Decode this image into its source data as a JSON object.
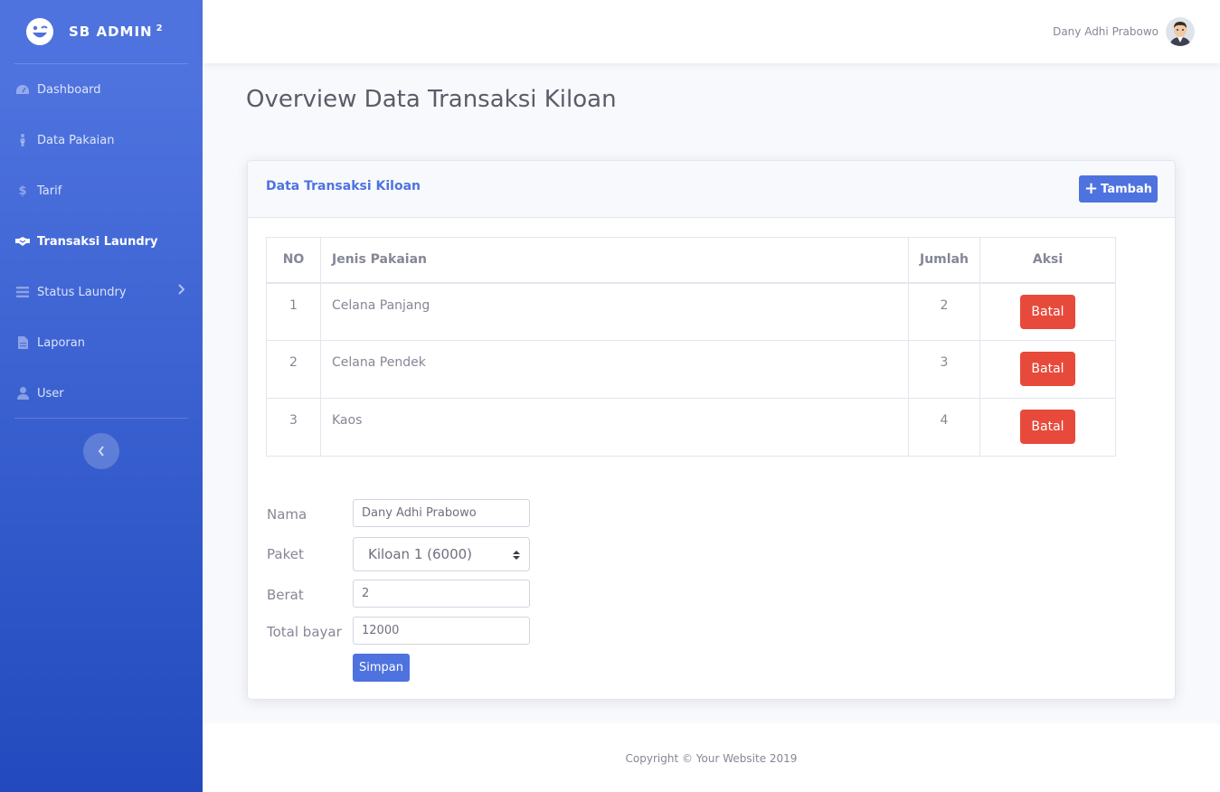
{
  "brand": {
    "name": "SB ADMIN",
    "sup": "2",
    "icon": "laugh-wink-icon"
  },
  "sidebar": {
    "items": [
      {
        "label": "Dashboard",
        "icon": "tachometer-icon"
      },
      {
        "label": "Data Pakaian",
        "icon": "person-icon"
      },
      {
        "label": "Tarif",
        "icon": "dollar-icon"
      },
      {
        "label": "Transaksi Laundry",
        "icon": "handshake-icon",
        "active": true
      },
      {
        "label": "Status Laundry",
        "icon": "bars-icon",
        "has_submenu": true
      },
      {
        "label": "Laporan",
        "icon": "file-icon"
      },
      {
        "label": "User",
        "icon": "user-icon"
      }
    ],
    "toggle_icon": "chevron-left-icon"
  },
  "topbar": {
    "user_name": "Dany Adhi Prabowo",
    "avatar_icon": "avatar"
  },
  "page": {
    "title": "Overview Data Transaksi Kiloan"
  },
  "card": {
    "title": "Data Transaksi Kiloan",
    "add_button": "Tambah",
    "table": {
      "headers": [
        "NO",
        "Jenis Pakaian",
        "Jumlah",
        "Aksi"
      ],
      "rows": [
        {
          "no": "1",
          "jenis": "Celana Panjang",
          "jumlah": "2",
          "aksi": "Batal"
        },
        {
          "no": "2",
          "jenis": "Celana Pendek",
          "jumlah": "3",
          "aksi": "Batal"
        },
        {
          "no": "3",
          "jenis": "Kaos",
          "jumlah": "4",
          "aksi": "Batal"
        }
      ]
    },
    "form": {
      "nama_label": "Nama",
      "nama_value": "Dany Adhi Prabowo",
      "paket_label": "Paket",
      "paket_value": "Kiloan 1 (6000)",
      "berat_label": "Berat",
      "berat_value": "2",
      "total_label": "Total bayar",
      "total_value": "12000",
      "submit": "Simpan"
    }
  },
  "footer": {
    "copyright": "Copyright © Your Website 2019"
  },
  "colors": {
    "primary": "#4e73df",
    "danger": "#e74a3b",
    "text": "#858796"
  }
}
